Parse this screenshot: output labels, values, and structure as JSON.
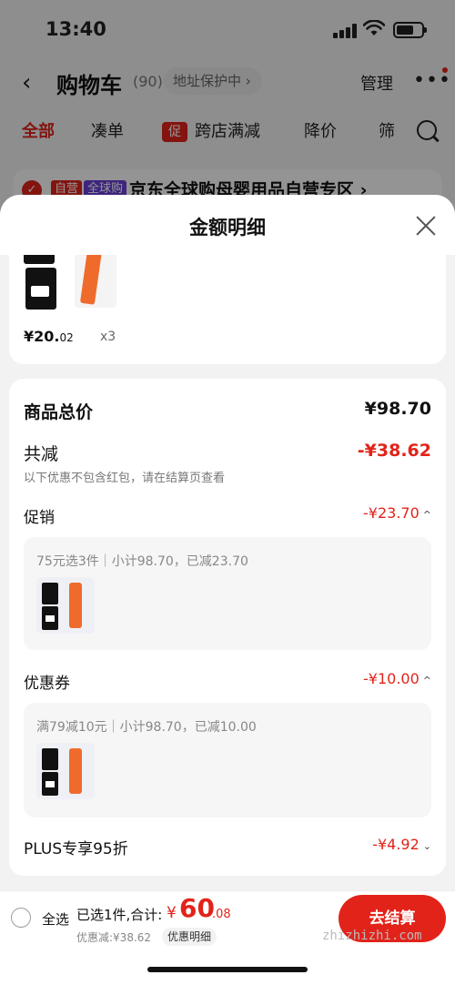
{
  "status_bar": {
    "time": "13:40"
  },
  "header": {
    "title": "购物车",
    "count": "(90)",
    "address_label": "地址保护中 ›",
    "manage": "管理",
    "more": "•••"
  },
  "tabs": [
    {
      "label": "全部"
    },
    {
      "label": "凑单"
    },
    {
      "label": "跨店满减",
      "tag": "促"
    },
    {
      "label": "降价"
    },
    {
      "label": "筛"
    }
  ],
  "store": {
    "tag_self": "自营",
    "tag_global": "全球购",
    "name": "京东全球购母婴用品自营专区 ›"
  },
  "sheet": {
    "title": "金额明细",
    "product": {
      "price_int": "¥20.",
      "price_dec": "02",
      "qty": "x3"
    },
    "total": {
      "label": "商品总价",
      "value": "¥98.70"
    },
    "reduce": {
      "label": "共减",
      "value": "-¥38.62",
      "note": "以下优惠不包含红包，请在结算页查看"
    },
    "promo": {
      "label": "促销",
      "value": "-¥23.70",
      "desc": "75元选3件｜小计98.70，已减23.70"
    },
    "coupon": {
      "label": "优惠券",
      "value": "-¥10.00",
      "desc": "满79减10元｜小计98.70，已减10.00"
    },
    "plus": {
      "label": "PLUS专享95折",
      "value": "-¥4.92"
    }
  },
  "bottom": {
    "select_all": "全选",
    "selected": "已选1件,合计:",
    "total_yen": "¥",
    "total_int": "60",
    "total_dec": ".08",
    "discount": "优惠减:¥38.62",
    "detail_btn": "优惠明细",
    "checkout": "去结算",
    "watermark": "zhizhizhi.com"
  },
  "colors": {
    "accent": "#e2231a",
    "dim": "rgba(0,0,0,0.42)"
  }
}
